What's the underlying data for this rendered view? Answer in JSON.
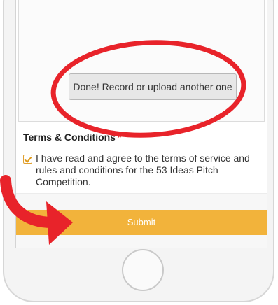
{
  "upload": {
    "done_button_label": "Done! Record or upload another one"
  },
  "terms": {
    "heading": "Terms & Conditions",
    "required_marker": "*",
    "checkbox_checked": true,
    "agreement_text": "I have read and agree to the terms of service and rules and conditions for the 53 Ideas Pitch Competition."
  },
  "form": {
    "submit_label": "Submit"
  },
  "colors": {
    "submit_bar": "#f2b33b",
    "annotation_red": "#e8232a",
    "checkbox_orange": "#e09b1c"
  }
}
